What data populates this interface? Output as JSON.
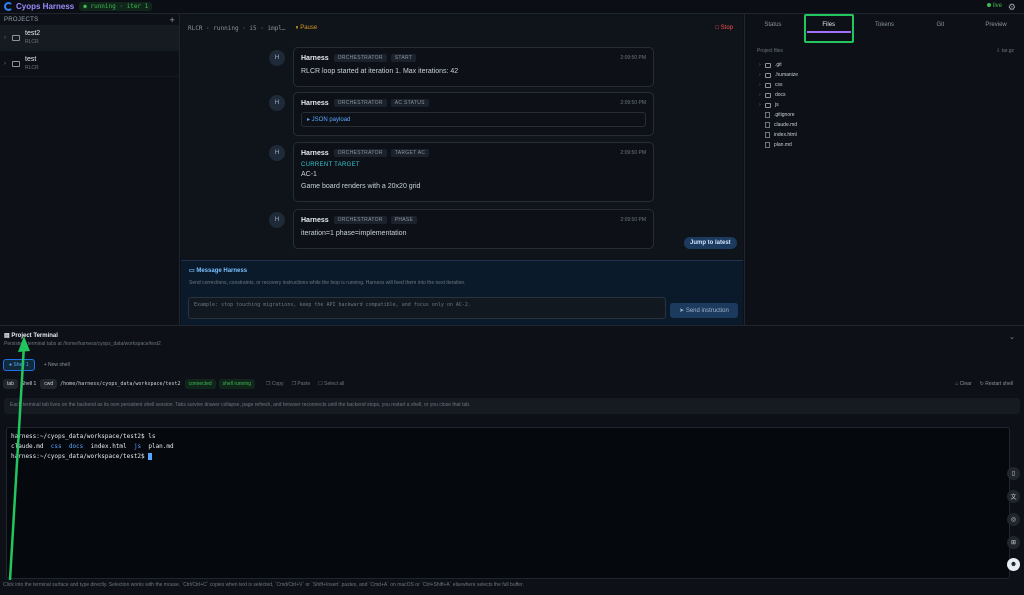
{
  "app": {
    "name": "Cyops Harness",
    "status_badge": "● running · iter 1",
    "live": "live"
  },
  "sidebar": {
    "heading": "PROJECTS",
    "add": "+",
    "projects": [
      {
        "name": "test2",
        "sub": "RLCR"
      },
      {
        "name": "test",
        "sub": "RLCR"
      }
    ]
  },
  "center": {
    "breadcrumb": "RLCR · running · i5 · impl…",
    "pause": "⏸ Pause",
    "stop": "□ Stop",
    "messages": [
      {
        "avatar": "H",
        "who": "Harness",
        "tags": [
          "ORCHESTRATOR",
          "START"
        ],
        "time": "2:09:50 PM",
        "body": "RLCR loop started at iteration 1. Max iterations: 42"
      },
      {
        "avatar": "H",
        "who": "Harness",
        "tags": [
          "ORCHESTRATOR",
          "AC STATUS"
        ],
        "time": "2:09:50 PM",
        "json": "▸ JSON payload"
      },
      {
        "avatar": "H",
        "who": "Harness",
        "tags": [
          "ORCHESTRATOR",
          "TARGET AC"
        ],
        "time": "2:09:50 PM",
        "label": "CURRENT TARGET",
        "ac": "AC-1",
        "body": "Game board renders with a 20x20 grid"
      },
      {
        "avatar": "H",
        "who": "Harness",
        "tags": [
          "ORCHESTRATOR",
          "PHASE"
        ],
        "time": "2:09:50 PM",
        "body": "iteration=1 phase=implementation"
      }
    ],
    "jump": "Jump to latest",
    "compose": {
      "title": "Message Harness",
      "hint": "Send corrections, constraints, or recovery instructions while the loop is running. Harness will feed them into the next iteration.",
      "placeholder": "Example: stop touching migrations, keep the API backward compatible, and focus only on AC-2.",
      "send": "➤ Send instruction"
    }
  },
  "right": {
    "tabs": [
      "Status",
      "Files",
      "Tokens",
      "Git",
      "Preview"
    ],
    "active_tab": "Files",
    "files_title": "Project files",
    "targz": "⇩ tar.gz",
    "files": [
      {
        "name": ".git",
        "type": "folder"
      },
      {
        "name": ".humanize",
        "type": "folder"
      },
      {
        "name": "css",
        "type": "folder"
      },
      {
        "name": "docs",
        "type": "folder"
      },
      {
        "name": "js",
        "type": "folder"
      },
      {
        "name": ".gitignore",
        "type": "file"
      },
      {
        "name": "claude.md",
        "type": "file"
      },
      {
        "name": "index.html",
        "type": "file"
      },
      {
        "name": "plan.md",
        "type": "file"
      }
    ]
  },
  "terminal": {
    "title": "Project Terminal",
    "subtitle": "Persistent terminal tabs at /home/harness/cyops_data/workspace/test2",
    "shell_tab": "● Shell 1",
    "new_shell": "+ New shell",
    "tab_label": "tab",
    "shell_name": "Shell 1",
    "cwd_label": "cwd",
    "cwd": "/home/harness/cyops_data/workspace/test2",
    "connected": "connected",
    "shell_running": "shell running",
    "copy": "❐ Copy",
    "paste": "❐ Paste",
    "select_all": "☐ Select all",
    "clear": "⌂ Clear",
    "restart": "↻ Restart shell",
    "tip": "Each terminal tab lives on the backend as its own persistent shell session. Tabs survive drawer collapse, page refresh, and browser reconnects until the backend stops, you restart a shell, or you close that tab.",
    "line1": "harness:~/cyops_data/workspace/test2$ ls",
    "ls_files": [
      "claude.md"
    ],
    "ls_dirs": [
      "css",
      "docs"
    ],
    "ls_files2": [
      "index.html"
    ],
    "ls_dirs2": [
      "js"
    ],
    "ls_files3": [
      "plan.md"
    ],
    "line3": "harness:~/cyops_data/workspace/test2$ ",
    "help": "Click into the terminal surface and type directly. Selection works with the mouse. `Ctrl/Ctrl+C` copies when text is selected, `Cmd/Ctrl+V` or `Shift+Insert` pastes, and `Cmd+A` on macOS or `Ctrl+Shift+A` elsewhere selects the full buffer."
  },
  "colors": {
    "accent": "#a371f7",
    "ok": "#3fb950",
    "link": "#58a6ff",
    "annotation": "#22c55e"
  },
  "icons": [
    "logo-icon",
    "gear-icon",
    "folder-icon",
    "file-icon",
    "chevron-icon",
    "chat-icon",
    "terminal-icon",
    "book-icon",
    "translate-icon",
    "settings-icon",
    "grid-icon",
    "bot-icon"
  ]
}
